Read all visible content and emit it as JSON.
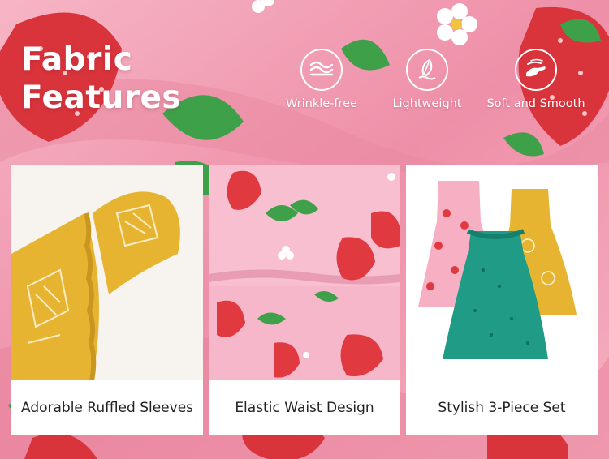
{
  "header": {
    "title_line1": "Fabric",
    "title_line2": "Features"
  },
  "features": [
    {
      "label": "Wrinkle-free",
      "icon": "wrinkle-free-icon"
    },
    {
      "label": "Lightweight",
      "icon": "feather-icon"
    },
    {
      "label": "Soft and Smooth",
      "icon": "hand-smooth-icon"
    }
  ],
  "cards": [
    {
      "caption": "Adorable Ruffled Sleeves"
    },
    {
      "caption": "Elastic Waist Design"
    },
    {
      "caption": "Stylish 3-Piece Set"
    }
  ],
  "colors": {
    "background_pink": "#f2a3b7",
    "strawberry_red": "#e0393f",
    "leaf_green": "#3fa04a",
    "pineapple_yellow": "#e7b431",
    "teal_dress": "#1f9b86"
  }
}
